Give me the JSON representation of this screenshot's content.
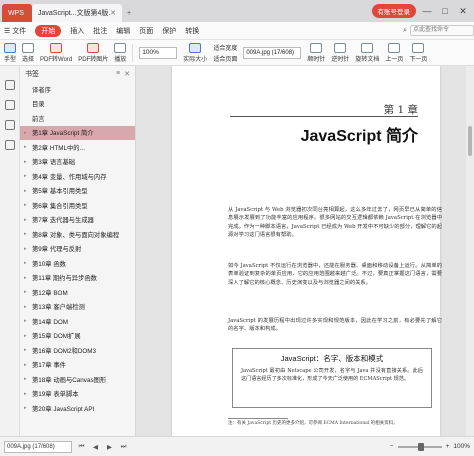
{
  "titlebar": {
    "home_tab": "WPS",
    "doc_tab": "JavaScript...文版第4版.pdf",
    "add_tab": "+",
    "login": "有账号登录",
    "controls": [
      "—",
      "□",
      "✕"
    ]
  },
  "menubar": {
    "items": [
      "☰ 文件",
      "开始",
      "插入",
      "批注",
      "编辑",
      "页面",
      "保护",
      "转换"
    ],
    "active_index": 1,
    "search_placeholder": "点此查找命令"
  },
  "toolbar": {
    "buttons": [
      "手型",
      "选择",
      "PDF转Word",
      "PDF转图片",
      "播放"
    ],
    "zoom_value": "100%",
    "fit_buttons": [
      "实际大小",
      "适合宽度",
      "适合页面"
    ],
    "page_value": "009A.jpg (17/608)",
    "right_buttons": [
      "顺时针",
      "逆时针",
      "旋转文档",
      "上一页",
      "下一页"
    ]
  },
  "sidebar": {
    "title": "书签",
    "tools": [
      "≡",
      "✕"
    ],
    "toc": [
      {
        "label": "译者序",
        "arrow": false
      },
      {
        "label": "目录",
        "arrow": false
      },
      {
        "label": "前言",
        "arrow": false
      },
      {
        "label": "第1章 JavaScript 简介",
        "arrow": true,
        "active": true
      },
      {
        "label": "第2章 HTML中的...",
        "arrow": true
      },
      {
        "label": "第3章 语言基础",
        "arrow": true
      },
      {
        "label": "第4章 变量、作用域与内存",
        "arrow": true
      },
      {
        "label": "第5章 基本引用类型",
        "arrow": true
      },
      {
        "label": "第6章 集合引用类型",
        "arrow": true
      },
      {
        "label": "第7章 迭代器与生成器",
        "arrow": true
      },
      {
        "label": "第8章 对象、类与面向对象编程",
        "arrow": true
      },
      {
        "label": "第9章 代理与反射",
        "arrow": true
      },
      {
        "label": "第10章 函数",
        "arrow": true
      },
      {
        "label": "第11章 期约与异步函数",
        "arrow": true
      },
      {
        "label": "第12章 BOM",
        "arrow": true
      },
      {
        "label": "第13章 客户端检测",
        "arrow": true
      },
      {
        "label": "第14章 DOM",
        "arrow": true
      },
      {
        "label": "第15章 DOM扩展",
        "arrow": true
      },
      {
        "label": "第16章 DOM2和DOM3",
        "arrow": true
      },
      {
        "label": "第17章 事件",
        "arrow": true
      },
      {
        "label": "第18章 动画与Canvas图形",
        "arrow": true
      },
      {
        "label": "第19章 表单脚本",
        "arrow": true
      },
      {
        "label": "第20章 JavaScript API",
        "arrow": true
      }
    ]
  },
  "document": {
    "chapter_num": "第 1 章",
    "chapter_title": "JavaScript 简介",
    "para1": "从 JavaScript 与 Web 浏览器初次同台亮相算起，这么多年过去了，网页早已从简单的信息展示发展到了功能丰富的应用程序。很多网站的交互逻辑都依赖 JavaScript 在浏览器中完成。作为一种脚本语言，JavaScript 已经成为 Web 开发中不可缺少的部分，理解它的起源对学习这门语言很有帮助。",
    "para2": "如今 JavaScript 不仅运行在浏览器中，还能在服务器、桌面和移动设备上运行。从简单的表单验证到复杂的单页应用，它的应用范围越来越广泛。不过，要真正掌握这门语言，需要深入了解它的核心概念、历史演变以及与浏览器之间的关系。",
    "para3": "JavaScript 的发展历程中出现过许多实现和规范版本，因此在学习之前，有必要先了解它的名字、版本和构成。",
    "box_title": "JavaScript：名字、版本和模式",
    "box_body": "JavaScript 最初由 Netscape 公司开发，名字与 Java 并没有直接关系。此后这门语言经历了多次标准化，形成了今天广泛使用的 ECMAScript 规范。",
    "footnote": "注：有关 JavaScript 历史的更多介绍，可参阅 ECMA International 的相关资料。"
  },
  "statusbar": {
    "page_field": "009A.jpg (17/608)",
    "nav": [
      "⏮",
      "◀",
      "▶",
      "⏭"
    ],
    "zoom": "100%",
    "zoom_minus": "−",
    "zoom_plus": "+"
  }
}
